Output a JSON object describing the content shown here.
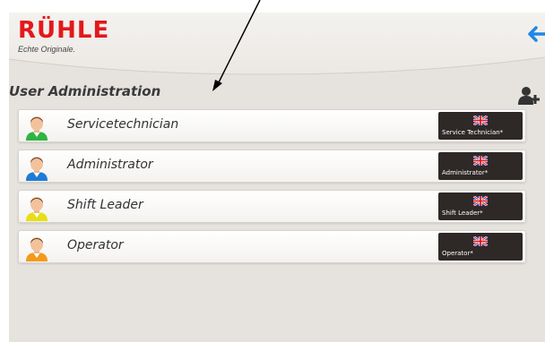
{
  "header": {
    "logo_text": "RÜHLE",
    "tagline": "Echte Originale.",
    "back_icon": "arrow-left-icon"
  },
  "page": {
    "title": "User Administration",
    "add_user_icon": "add-user-icon"
  },
  "users": [
    {
      "name": "Servicetechnician",
      "role_label": "Service Technician*",
      "avatar_color": "#2fb543"
    },
    {
      "name": "Administrator",
      "role_label": "Administrator*",
      "avatar_color": "#1e7bd6"
    },
    {
      "name": "Shift Leader",
      "role_label": "Shift Leader*",
      "avatar_color": "#e6df16"
    },
    {
      "name": "Operator",
      "role_label": "Operator*",
      "avatar_color": "#f39a1b"
    }
  ],
  "colors": {
    "accent_blue": "#1e88e5",
    "brand_red": "#e4181b",
    "badge_bg": "#2e2827"
  }
}
